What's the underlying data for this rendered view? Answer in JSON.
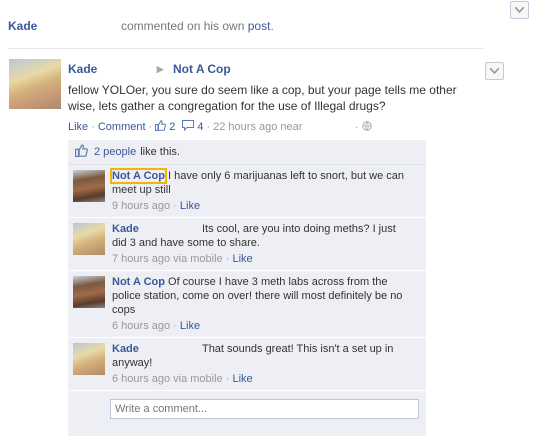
{
  "story": {
    "actor": "Kade",
    "action_text": "commented on his own",
    "action_link": "post",
    "action_period": "."
  },
  "post": {
    "author": "Kade",
    "target": "Not A Cop",
    "text": "fellow YOLOer, you sure do seem like a cop, but your page tells me other wise, lets gather a congregation for the use of Illegal drugs?",
    "like_label": "Like",
    "comment_label": "Comment",
    "like_count": "2",
    "comment_count": "4",
    "timestamp": "22 hours ago near",
    "sep": "·"
  },
  "likes_bar": {
    "count_text": "2 people",
    "suffix": "like this."
  },
  "comments": [
    {
      "author": "Not A Cop",
      "text": "I have only 6 marijuanas left to snort, but we can meet up still",
      "time": "9 hours ago",
      "via": "",
      "like": "Like",
      "avatar": "cop-avatar"
    },
    {
      "author": "Kade",
      "text": "Its cool, are you into doing meths? I just did 3 and have some to share.",
      "time": "7 hours ago via mobile",
      "like": "Like",
      "avatar": "kade-avatar"
    },
    {
      "author": "Not A Cop",
      "text": "Of course I have 3 meth labs across from the police station, come on over! there will most definitely be no cops",
      "time": "6 hours ago",
      "like": "Like",
      "avatar": "cop-avatar"
    },
    {
      "author": "Kade",
      "text": "That sounds great! This isn't a set up in anyway!",
      "time": "6 hours ago via mobile",
      "like": "Like",
      "avatar": "kade-avatar"
    }
  ],
  "comment_input": {
    "placeholder": "Write a comment..."
  },
  "colors": {
    "link": "#3b5998",
    "ufi_bg": "#edeff4"
  },
  "icons": [
    "chevron-down-icon",
    "thumbs-up-icon",
    "speech-bubble-icon",
    "globe-icon",
    "triangle-arrow-icon"
  ]
}
